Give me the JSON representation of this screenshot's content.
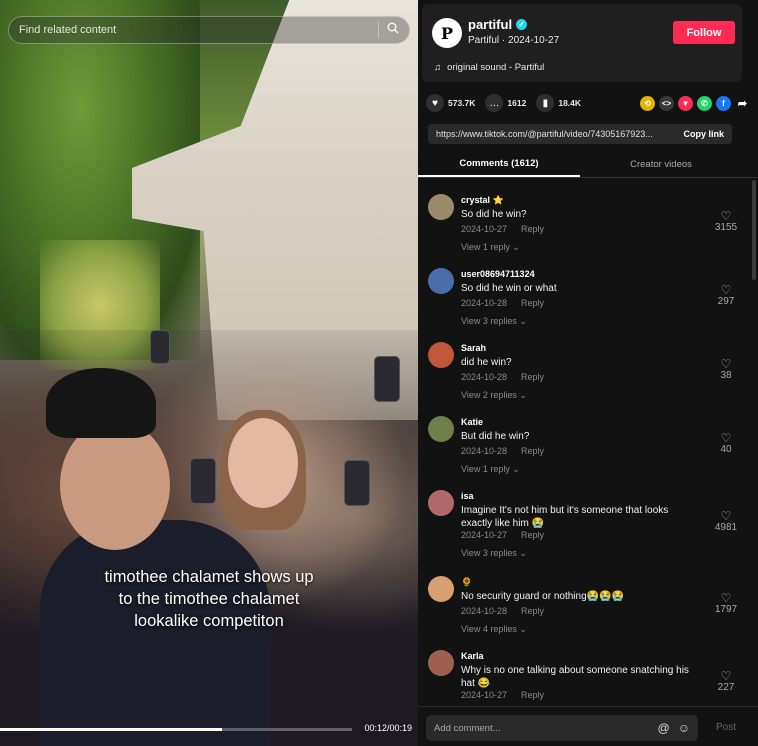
{
  "video": {
    "search_placeholder": "Find related content",
    "caption_lines": [
      "timothee chalamet shows up",
      "to the timothee chalamet",
      "lookalike competiton"
    ],
    "time": "00:12/00:19",
    "progress": 0.63
  },
  "author": {
    "avatar_letter": "P",
    "name": "partiful",
    "verified_glyph": "✓",
    "subtitle": "Partiful · 2024-10-27",
    "follow_label": "Follow",
    "music_icon": "♫",
    "music": "original sound - Partiful"
  },
  "stats": {
    "likes": "573.7K",
    "comments": "1612",
    "saves": "18.4K"
  },
  "share": {
    "url": "https://www.tiktok.com/@partiful/video/74305167923...",
    "copy_label": "Copy link"
  },
  "tabs": [
    {
      "label": "Comments (1612)"
    },
    {
      "label": "Creator videos"
    }
  ],
  "comments": [
    {
      "name": "crystal ⭐",
      "text": "So did he win?",
      "date": "2024-10-27",
      "reply": "Reply",
      "replies": "View 1 reply ⌄",
      "likes": "3155",
      "avatar_color": "#9a8a6a"
    },
    {
      "name": "user08694711324",
      "text": "So did he win or what",
      "date": "2024-10-28",
      "reply": "Reply",
      "replies": "View 3 replies ⌄",
      "likes": "297",
      "avatar_color": "#4a6fa8"
    },
    {
      "name": "Sarah",
      "text": "did he win?",
      "date": "2024-10-28",
      "reply": "Reply",
      "replies": "View 2 replies ⌄",
      "likes": "38",
      "avatar_color": "#c0563a"
    },
    {
      "name": "Katie",
      "text": "But did he win?",
      "date": "2024-10-28",
      "reply": "Reply",
      "replies": "View 1 reply ⌄",
      "likes": "40",
      "avatar_color": "#6f7f4a"
    },
    {
      "name": "isa",
      "text": "Imagine It's not him but it's someone that looks exactly like him 😭",
      "date": "2024-10-27",
      "reply": "Reply",
      "replies": "View 3 replies ⌄",
      "likes": "4981",
      "avatar_color": "#b06a6a"
    },
    {
      "name": "🌻",
      "text": "No security guard or nothing😭😭😭",
      "date": "2024-10-28",
      "reply": "Reply",
      "replies": "View 4 replies ⌄",
      "likes": "1797",
      "avatar_color": "#d8a070"
    },
    {
      "name": "Karla",
      "text": "Why is no one talking about someone snatching his hat 😂",
      "date": "2024-10-27",
      "reply": "Reply",
      "replies": "",
      "likes": "227",
      "avatar_color": "#a06050"
    }
  ],
  "bottom": {
    "placeholder": "Add comment...",
    "post_label": "Post"
  },
  "colors": {
    "accent": "#fe2c55",
    "background": "#121212",
    "panel": "#1f1f1f"
  }
}
